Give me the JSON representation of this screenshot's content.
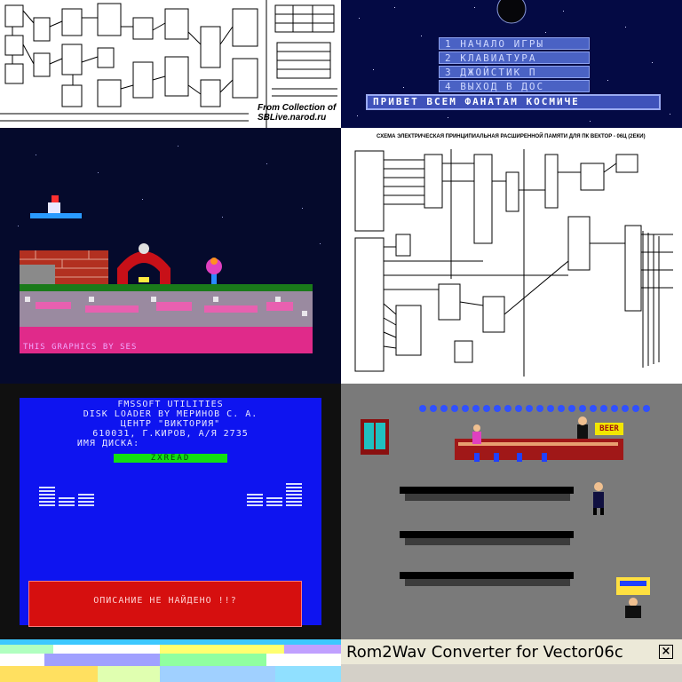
{
  "tiles": {
    "schematic_top": {
      "credit_line1": "From Collection of",
      "credit_line2": "SBLive.narod.ru"
    },
    "game_menu": {
      "items": [
        "1 НАЧАЛО ИГРЫ",
        "2 КЛАВИАТУРА",
        "3 ДЖОЙСТИК П",
        "4 ВЫХОД В ДОС"
      ],
      "banner": "ПРИВЕТ ВСЕМ ФАНАТАМ КОСМИЧЕ"
    },
    "platformer": {
      "caption": "THIS GRAPHICS BY SES"
    },
    "memory_schematic": {
      "title": "СХЕМА ЭЛЕКТРИЧЕСКАЯ ПРИНЦИПИАЛЬНАЯ РАСШИРЕННОЙ ПАМЯТИ ДЛЯ ПК ВЕКТОР - 06Ц (2ЕКИ)"
    },
    "disk_loader": {
      "header_lines": [
        "FMSSOFT  UTILITIES",
        "DISK LOADER BY МЕРИНОВ С. А.",
        "ЦЕНТР \"ВИКТОРИЯ\"",
        "610031, Г.КИРОВ, А/Я 2735",
        "ИМЯ ДИСКА:"
      ],
      "disk_name": "ZXREAD",
      "message": "ОПИСАНИЕ НЕ НАЙДЕНО !!?"
    },
    "bar_game": {
      "sign": "BEER"
    },
    "rom2wav": {
      "window_title": "Rom2Wav Converter for Vector06c",
      "close_label": "×"
    }
  },
  "colors": {
    "menu_bg": "#040a44",
    "loader_blue": "#0e14f0",
    "alert_red": "#d60f0f",
    "bar_gray": "#7a7a7a",
    "xp_titlebar": "#ece9d8"
  }
}
